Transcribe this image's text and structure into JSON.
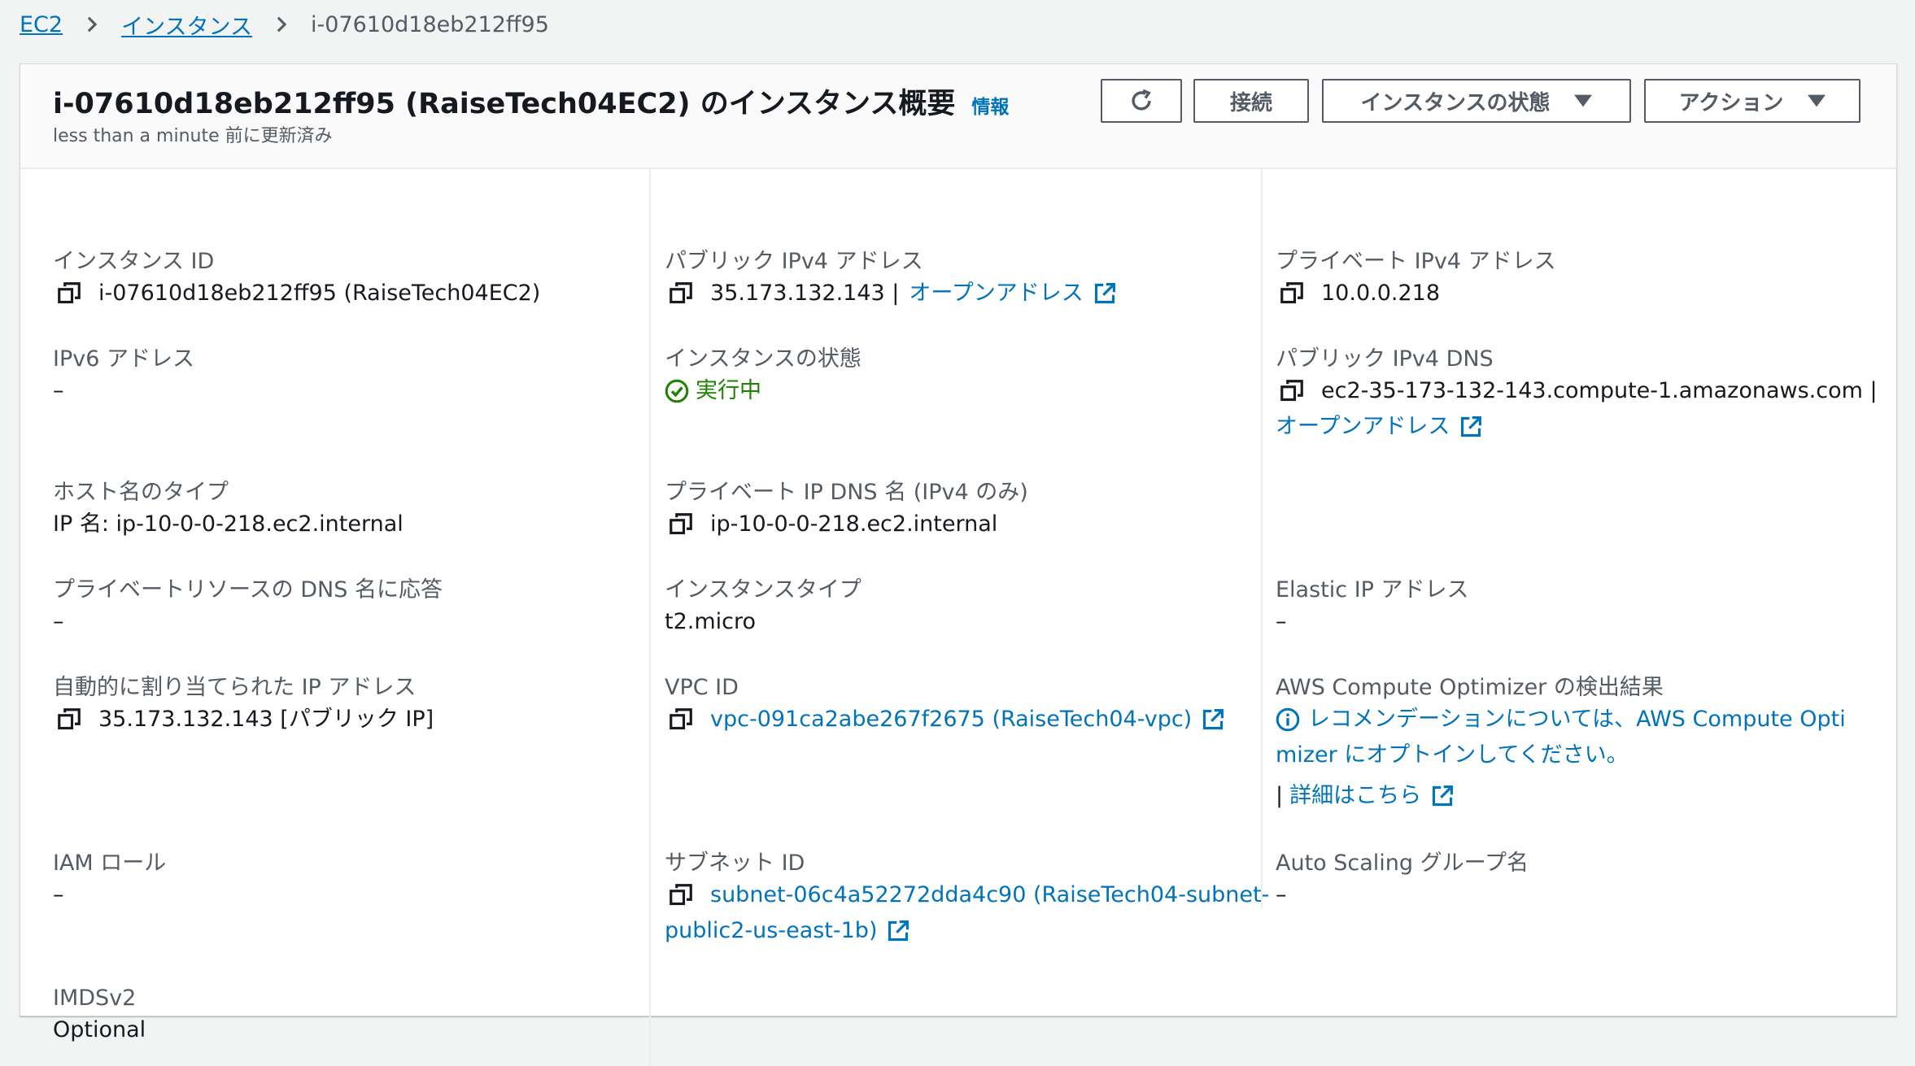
{
  "breadcrumb": {
    "items": [
      "EC2",
      "インスタンス"
    ],
    "current": "i-07610d18eb212ff95"
  },
  "header": {
    "title": "i-07610d18eb212ff95 (RaiseTech04EC2) のインスタンス概要",
    "info_link": "情報",
    "subtitle": "less than a minute 前に更新済み",
    "refresh_icon": "refresh-icon",
    "connect_label": "接続",
    "state_label": "インスタンスの状態",
    "actions_label": "アクション"
  },
  "colors": {
    "link": "#0073bb",
    "status_running": "#1d8102",
    "label": "#545b64",
    "text": "#16191f"
  },
  "details": {
    "instance_id": {
      "label": "インスタンス ID",
      "value": "i-07610d18eb212ff95 (RaiseTech04EC2)"
    },
    "public_ipv4": {
      "label": "パブリック IPv4 アドレス",
      "value": "35.173.132.143 |",
      "link": "オープンアドレス"
    },
    "private_ipv4": {
      "label": "プライベート IPv4 アドレス",
      "value": "10.0.0.218"
    },
    "ipv6": {
      "label": "IPv6 アドレス",
      "value": "–"
    },
    "instance_state": {
      "label": "インスタンスの状態",
      "value": "実行中"
    },
    "public_dns": {
      "label": "パブリック IPv4 DNS",
      "value": "ec2-35-173-132-143.compute-1.amazonaws.com |",
      "link": "オープンアドレス"
    },
    "hostname_type": {
      "label": "ホスト名のタイプ",
      "value": "IP 名: ip-10-0-0-218.ec2.internal"
    },
    "private_dns": {
      "label": "プライベート IP DNS 名 (IPv4 のみ)",
      "value": "ip-10-0-0-218.ec2.internal"
    },
    "resource_dns": {
      "label": "プライベートリソースの DNS 名に応答",
      "value": "–"
    },
    "instance_type": {
      "label": "インスタンスタイプ",
      "value": "t2.micro"
    },
    "elastic_ip": {
      "label": "Elastic IP アドレス",
      "value": "–"
    },
    "auto_ip": {
      "label": "自動的に割り当てられた IP アドレス",
      "value": "35.173.132.143 [パブリック IP]"
    },
    "vpc_id": {
      "label": "VPC ID",
      "value": "vpc-091ca2abe267f2675 (RaiseTech04-vpc)"
    },
    "optimizer": {
      "label": "AWS Compute Optimizer の検出結果",
      "line1": "レコメンデーションについては、AWS Compute Opti",
      "line2": "mizer にオプトインしてください。",
      "prefix": "|",
      "details_link": "詳細はこちら"
    },
    "iam_role": {
      "label": "IAM ロール",
      "value": "–"
    },
    "subnet_id": {
      "label": "サブネット ID",
      "line1": "subnet-06c4a52272dda4c90 (RaiseTech04-subnet-",
      "line2": "public2-us-east-1b)"
    },
    "asg_name": {
      "label": "Auto Scaling グループ名",
      "value": "–"
    },
    "imdsv2": {
      "label": "IMDSv2",
      "value": "Optional"
    }
  }
}
